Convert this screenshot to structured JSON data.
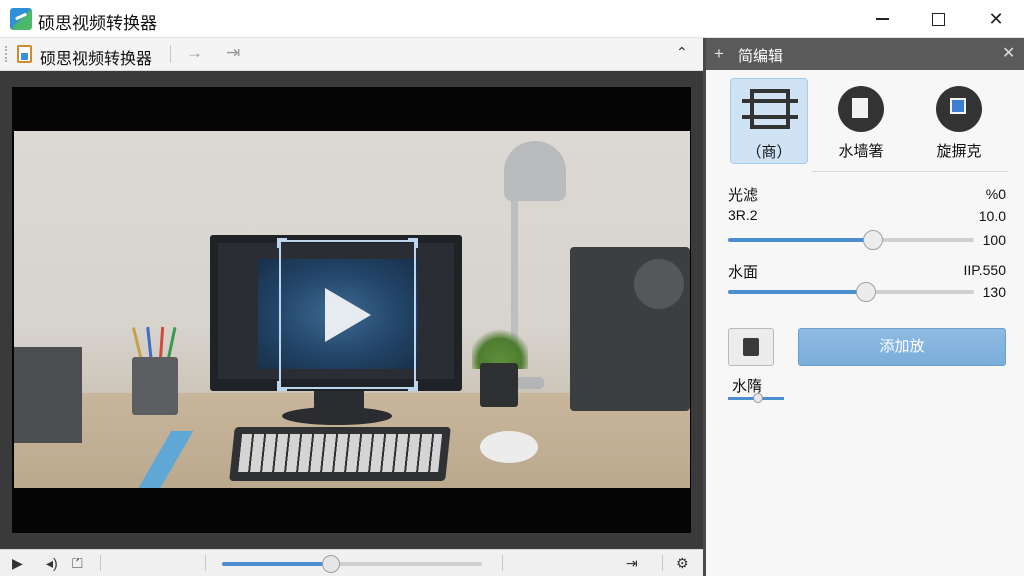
{
  "window": {
    "title": "硕思视频转换器",
    "controls": {
      "minimize": "",
      "maximize": "",
      "close": "✕"
    }
  },
  "toolbar": {
    "project_name": "硕思视频转换器",
    "arrow_right": "→",
    "arrow_to_end": "⇥",
    "collapse": "⌃"
  },
  "player": {
    "play": "▶",
    "volume": "◂)",
    "clip": "⏍",
    "timeline_progress": 0.42,
    "end_marker": "⇥",
    "settings": "⚙"
  },
  "panel": {
    "header_icon": "+",
    "title": "简编辑",
    "close": "✕",
    "tools": [
      {
        "label": "（商）",
        "icon": "crop-icon",
        "selected": true
      },
      {
        "label": "水墙箸",
        "icon": "paint-icon",
        "selected": false
      },
      {
        "label": "旋摒克",
        "icon": "rotate-icon",
        "selected": false
      }
    ],
    "brightness": {
      "label": "光滤",
      "right_top": "%0",
      "sub_label": "3R.2",
      "sub_value": "10.0",
      "max_value": "100",
      "level": 0.59
    },
    "level": {
      "label": "水面",
      "right_top": "IIP.550",
      "max_value": "130",
      "level": 0.56
    },
    "apply_button": "添加放",
    "mini_label": "水隋",
    "mini_level": 0.55
  },
  "colors": {
    "accent": "#4b8fd0",
    "panel_header": "#5a5a5a",
    "selected_tool": "#cfe3f5",
    "apply_button": "#7aadd9"
  }
}
